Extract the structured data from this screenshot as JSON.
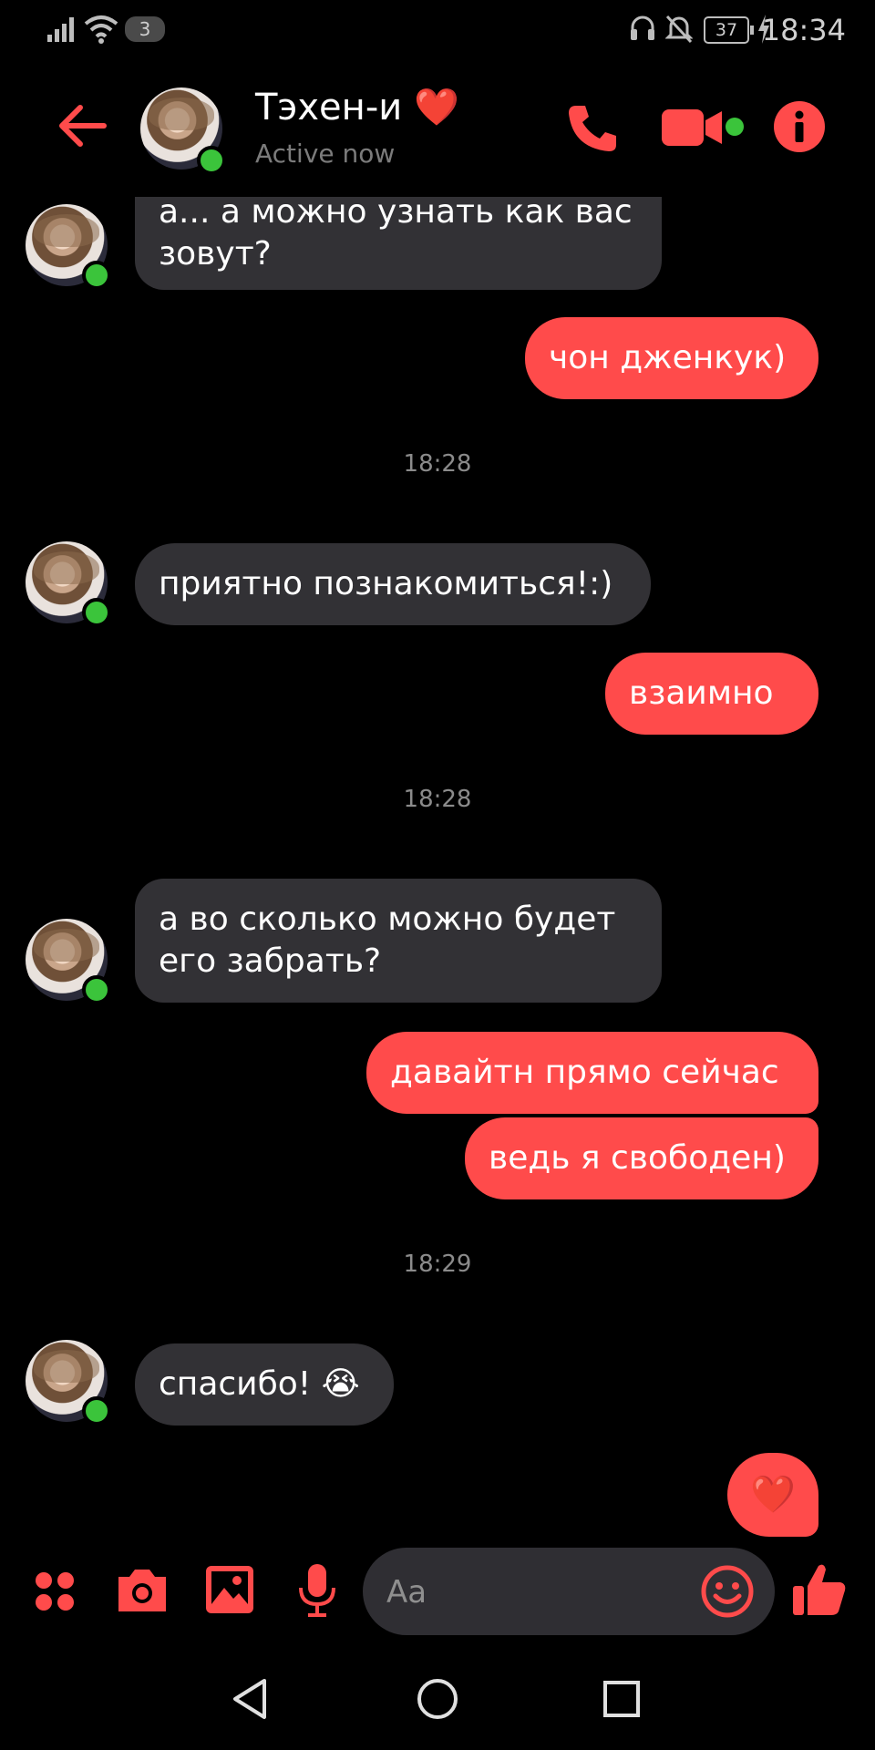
{
  "status_bar": {
    "notification_count": "3",
    "battery_level": "37",
    "time": "18:34"
  },
  "header": {
    "contact_name": "Тэхен-и ❤️",
    "status": "Active now"
  },
  "messages": [
    {
      "text_line1": "а... а можно узнать как вас",
      "text_line2": "зовут?"
    },
    {
      "text": "чон дженкук)"
    },
    {
      "timestamp": "18:28"
    },
    {
      "text": "приятно познакомиться!:)"
    },
    {
      "text": "взаимно"
    },
    {
      "timestamp": "18:28"
    },
    {
      "text_line1": "а во сколько можно будет",
      "text_line2": "его забрать?"
    },
    {
      "text": "давайтн прямо сейчас"
    },
    {
      "text": "ведь я свободен)"
    },
    {
      "timestamp": "18:29"
    },
    {
      "text": "спасибо! 😭"
    },
    {
      "text": "❤️"
    }
  ],
  "composer": {
    "placeholder": "Aa"
  },
  "colors": {
    "accent": "#ff4b4b",
    "incoming_bubble": "#323135",
    "online": "#3bc43b"
  }
}
